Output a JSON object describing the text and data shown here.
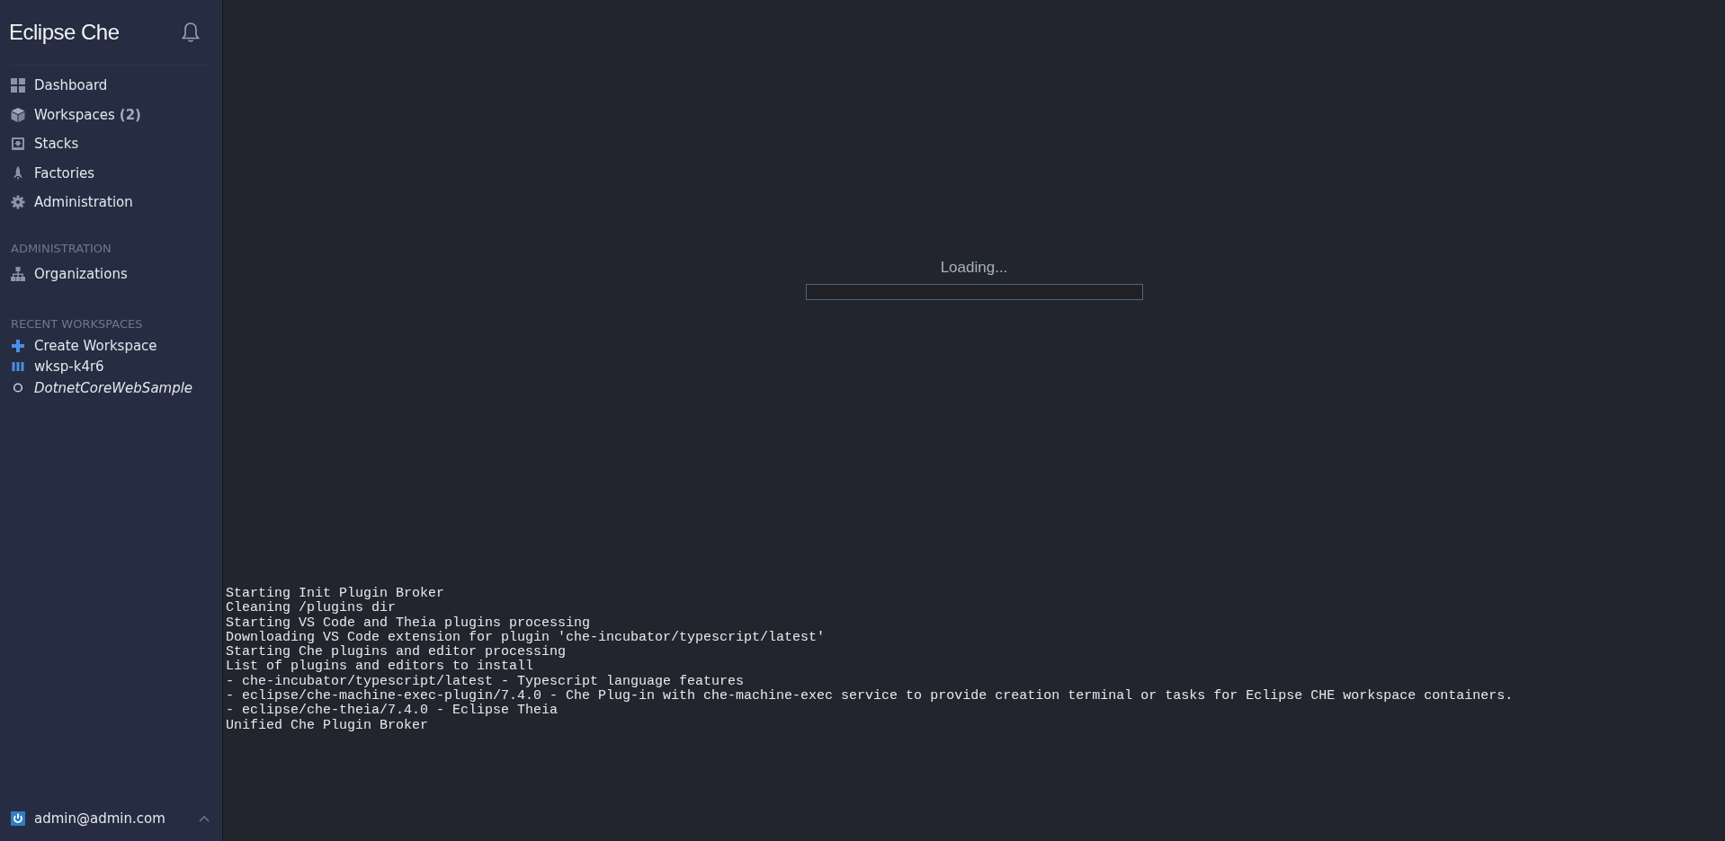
{
  "sidebar": {
    "logo": "Eclipse Che",
    "nav_items": [
      {
        "kind": "dashboard",
        "label": "Dashboard"
      },
      {
        "kind": "workspaces",
        "label": "Workspaces",
        "count": "(2)"
      },
      {
        "kind": "stacks",
        "label": "Stacks"
      },
      {
        "kind": "factories",
        "label": "Factories"
      },
      {
        "kind": "administration",
        "label": "Administration"
      }
    ],
    "admin_section": {
      "heading": "ADMINISTRATION",
      "items": [
        {
          "kind": "organizations",
          "label": "Organizations"
        }
      ]
    },
    "recent_section": {
      "heading": "RECENT WORKSPACES",
      "items": [
        {
          "kind": "create",
          "label": "Create Workspace"
        },
        {
          "kind": "running",
          "label": "wksp-k4r6"
        },
        {
          "kind": "stopped",
          "label": "DotnetCoreWebSample"
        }
      ]
    },
    "user": {
      "email": "admin@admin.com"
    }
  },
  "main": {
    "loading_text": "Loading...",
    "loading_progress": {
      "level": 0
    },
    "log_lines": [
      "Starting Init Plugin Broker",
      "Cleaning /plugins dir",
      "Starting VS Code and Theia plugins processing",
      "Downloading VS Code extension for plugin 'che-incubator/typescript/latest'",
      "Starting Che plugins and editor processing",
      "List of plugins and editors to install",
      "- che-incubator/typescript/latest - Typescript language features",
      "- eclipse/che-machine-exec-plugin/7.4.0 - Che Plug-in with che-machine-exec service to provide creation terminal or tasks for Eclipse CHE workspace containers.",
      "- eclipse/che-theia/7.4.0 - Eclipse Theia",
      "Unified Che Plugin Broker"
    ]
  }
}
